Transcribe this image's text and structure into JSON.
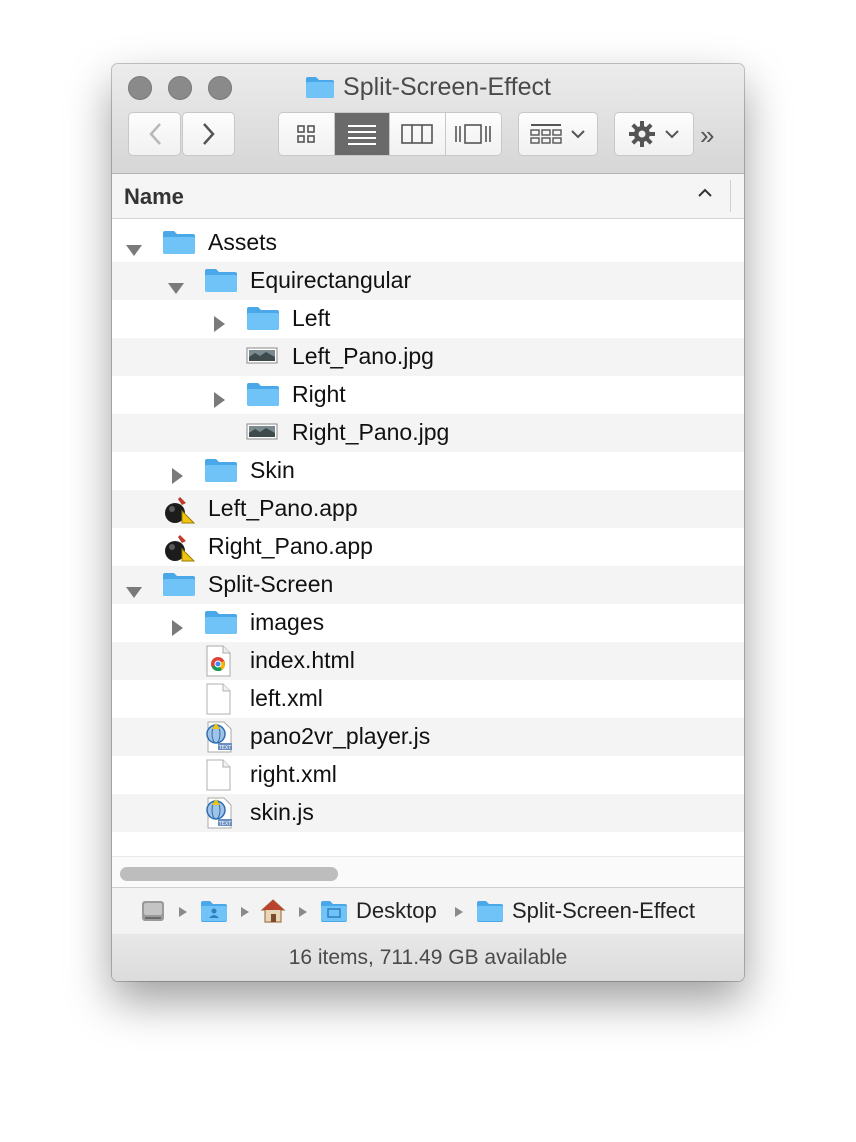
{
  "window": {
    "title": "Split-Screen-Effect"
  },
  "toolbar": {
    "back_icon": "chevron-left-icon",
    "forward_icon": "chevron-right-icon",
    "view_modes": [
      "icon-view-icon",
      "list-view-icon",
      "column-view-icon",
      "coverflow-view-icon"
    ],
    "active_view": "list-view-icon",
    "arrange_icon": "arrange-grid-icon",
    "action_icon": "gear-icon",
    "more_label": "»"
  },
  "header": {
    "name_label": "Name",
    "sort_icon": "chevron-up-icon"
  },
  "files": [
    {
      "name": "Assets",
      "depth": 0,
      "type": "folder",
      "disclosure": "expanded"
    },
    {
      "name": "Equirectangular",
      "depth": 1,
      "type": "folder",
      "disclosure": "expanded"
    },
    {
      "name": "Left",
      "depth": 2,
      "type": "folder",
      "disclosure": "collapsed"
    },
    {
      "name": "Left_Pano.jpg",
      "depth": 2,
      "type": "image",
      "disclosure": "none"
    },
    {
      "name": "Right",
      "depth": 2,
      "type": "folder",
      "disclosure": "collapsed"
    },
    {
      "name": "Right_Pano.jpg",
      "depth": 2,
      "type": "image",
      "disclosure": "none"
    },
    {
      "name": "Skin",
      "depth": 1,
      "type": "folder",
      "disclosure": "collapsed"
    },
    {
      "name": "Left_Pano.app",
      "depth": 0,
      "type": "app",
      "disclosure": "none"
    },
    {
      "name": "Right_Pano.app",
      "depth": 0,
      "type": "app",
      "disclosure": "none"
    },
    {
      "name": "Split-Screen",
      "depth": 0,
      "type": "folder",
      "disclosure": "expanded"
    },
    {
      "name": "images",
      "depth": 1,
      "type": "folder",
      "disclosure": "collapsed"
    },
    {
      "name": "index.html",
      "depth": 1,
      "type": "html",
      "disclosure": "none"
    },
    {
      "name": "left.xml",
      "depth": 1,
      "type": "doc",
      "disclosure": "none"
    },
    {
      "name": "pano2vr_player.js",
      "depth": 1,
      "type": "script",
      "disclosure": "none"
    },
    {
      "name": "right.xml",
      "depth": 1,
      "type": "doc",
      "disclosure": "none"
    },
    {
      "name": "skin.js",
      "depth": 1,
      "type": "script",
      "disclosure": "none"
    }
  ],
  "pathbar": {
    "items": [
      {
        "icon": "hard-drive-icon",
        "label": ""
      },
      {
        "icon": "user-folder-icon",
        "label": ""
      },
      {
        "icon": "home-icon",
        "label": ""
      },
      {
        "icon": "desktop-folder-icon",
        "label": "Desktop"
      },
      {
        "icon": "folder-icon",
        "label": "Split-Screen-Effect"
      }
    ]
  },
  "status": {
    "text": "16 items, 711.49 GB available"
  },
  "colors": {
    "folder": "#6fc3f7",
    "folder_dark": "#4aa8e8",
    "selection_active": "#6a6a6a"
  }
}
